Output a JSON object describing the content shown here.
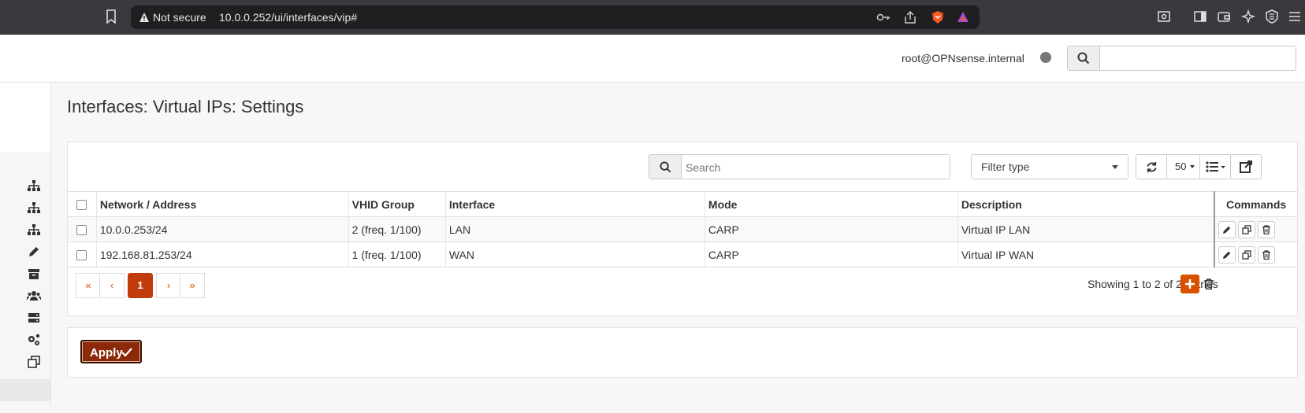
{
  "browser": {
    "security_label": "Not secure",
    "url": "10.0.0.252/ui/interfaces/vip#"
  },
  "header": {
    "user": "root@OPNsense.internal",
    "search_placeholder": ""
  },
  "page": {
    "title": "Interfaces: Virtual IPs: Settings"
  },
  "grid": {
    "search_placeholder": "Search",
    "filter_label": "Filter type",
    "row_count_option": "50",
    "columns": [
      "Network / Address",
      "VHID Group",
      "Interface",
      "Mode",
      "Description",
      "Commands"
    ],
    "rows": [
      {
        "address": "10.0.0.253/24",
        "vhid": "2 (freq. 1/100)",
        "interface": "LAN",
        "mode": "CARP",
        "description": "Virtual IP LAN"
      },
      {
        "address": "192.168.81.253/24",
        "vhid": "1 (freq. 1/100)",
        "interface": "WAN",
        "mode": "CARP",
        "description": "Virtual IP WAN"
      }
    ],
    "pagination": {
      "first": "«",
      "prev": "‹",
      "current": "1",
      "next": "›",
      "last": "»"
    },
    "showing_text": "Showing 1 to 2 of 2 entries"
  },
  "actions": {
    "apply_label": "Apply"
  },
  "colors": {
    "accent": "#d94f00",
    "apply_bg": "#8a2a08"
  }
}
